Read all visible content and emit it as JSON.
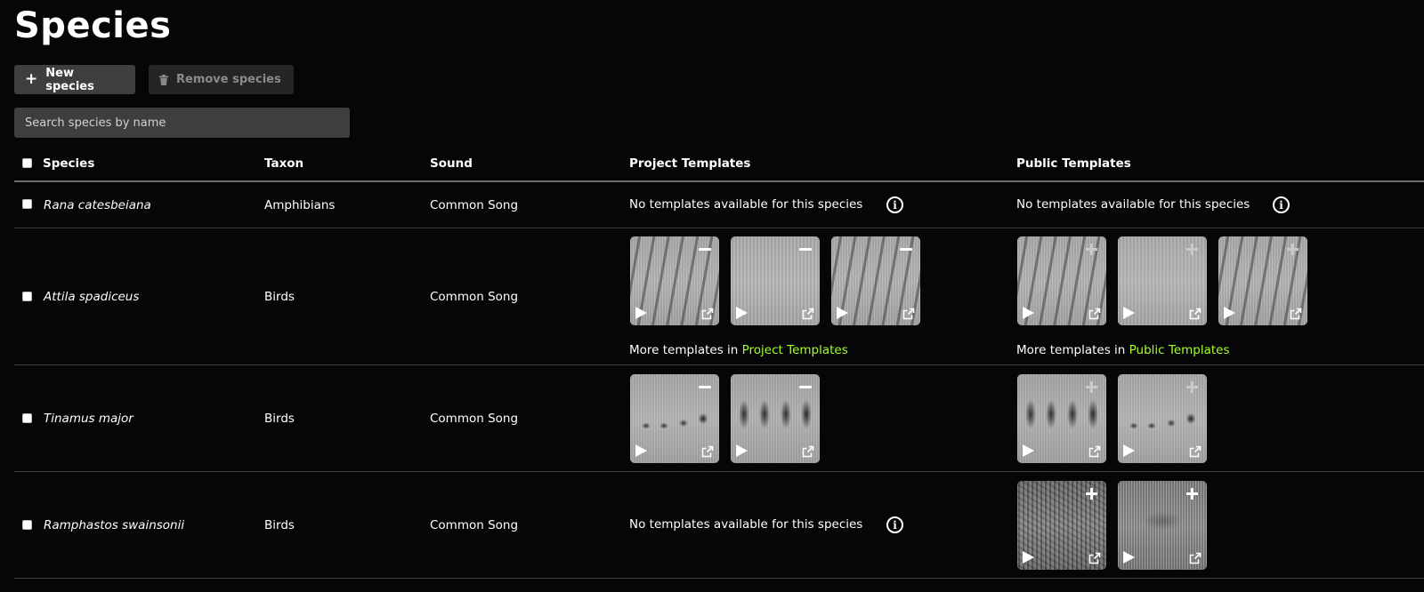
{
  "page": {
    "title": "Species"
  },
  "toolbar": {
    "new_label": "New species",
    "new_icon": "plus-icon",
    "remove_label": "Remove species",
    "remove_icon": "trash-icon"
  },
  "search": {
    "placeholder": "Search species by name",
    "value": ""
  },
  "table": {
    "headers": [
      "Species",
      "Taxon",
      "Sound",
      "Project Templates",
      "Public Templates"
    ],
    "rows": [
      {
        "species": "Rana catesbeiana",
        "taxon": "Amphibians",
        "sound": "Common Song",
        "project_empty": "No templates available for this species",
        "public_empty": "No templates available for this species"
      },
      {
        "species": "Attila spadiceus",
        "taxon": "Birds",
        "sound": "Common Song",
        "more_project": {
          "prefix": "More templates in",
          "link": "Project Templates"
        },
        "more_public": {
          "prefix": "More templates in",
          "link": "Public Templates"
        }
      },
      {
        "species": "Tinamus major",
        "taxon": "Birds",
        "sound": "Common Song"
      },
      {
        "species": "Ramphastos swainsonii",
        "taxon": "Birds",
        "sound": "Common Song",
        "project_empty": "No templates available for this species"
      }
    ]
  },
  "icons": {
    "info": "info-icon",
    "remove": "minus-icon",
    "add": "plus-icon",
    "play": "play-icon",
    "open": "external-link-icon"
  },
  "colors": {
    "background": "#060608",
    "accent_link": "#a6ff2c",
    "button_bg": "#3d3e40",
    "disabled_button_bg": "#242526"
  }
}
